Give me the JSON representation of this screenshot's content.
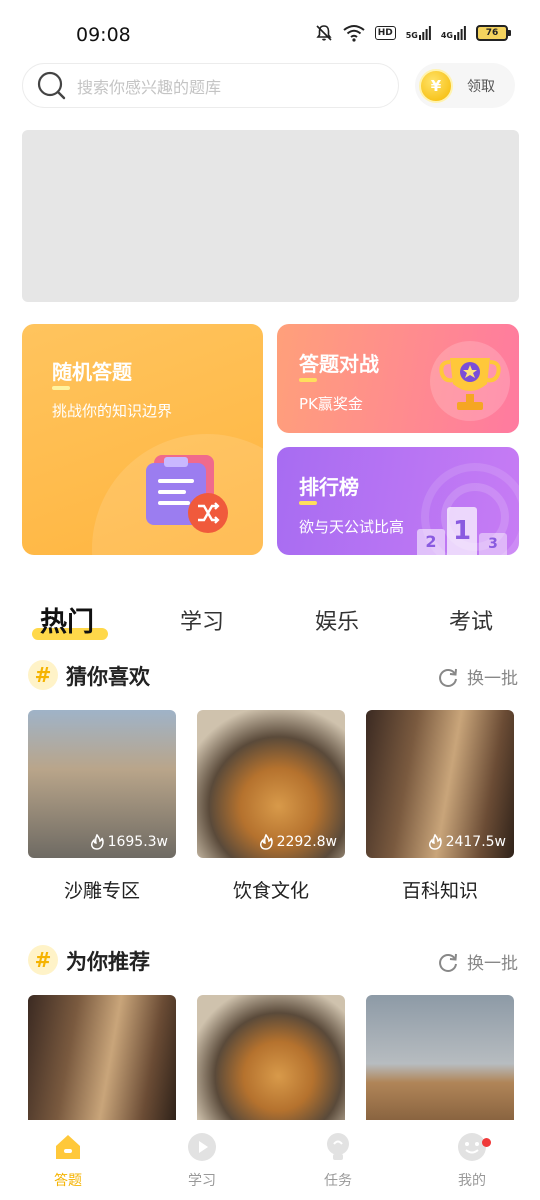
{
  "status_bar": {
    "time": "09:08",
    "hd": "HD",
    "net1": "5G",
    "net2": "4G",
    "battery": "76"
  },
  "search": {
    "placeholder": "搜索你感兴趣的题库",
    "reward_label": "领取",
    "coin_symbol": "¥"
  },
  "features": {
    "random": {
      "title": "随机答题",
      "subtitle": "挑战你的知识边界"
    },
    "battle": {
      "title": "答题对战",
      "subtitle": "PK赢奖金"
    },
    "rank": {
      "title": "排行榜",
      "subtitle": "欲与天公试比高",
      "podium": [
        "2",
        "1",
        "3"
      ]
    }
  },
  "tabs": [
    "热门",
    "学习",
    "娱乐",
    "考试"
  ],
  "guess": {
    "title": "猜你喜欢",
    "refresh": "换一批",
    "items": [
      {
        "label": "沙雕专区",
        "count": "1695.3w"
      },
      {
        "label": "饮食文化",
        "count": "2292.8w"
      },
      {
        "label": "百科知识",
        "count": "2417.5w"
      }
    ]
  },
  "recommend": {
    "title": "为你推荐",
    "refresh": "换一批"
  },
  "bottom_nav": [
    "答题",
    "学习",
    "任务",
    "我的"
  ],
  "colors": {
    "accent": "#f5b300",
    "random_card": "#ffb53f",
    "battle_card": "#ff7aa0",
    "rank_card": "#a76cf2",
    "badge": "#f03a3a"
  }
}
